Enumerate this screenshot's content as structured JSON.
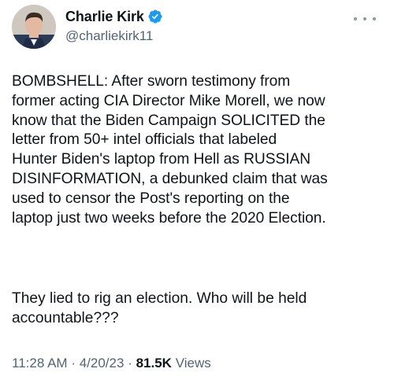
{
  "author": {
    "name": "Charlie Kirk",
    "handle": "@charliekirk11",
    "verified": true,
    "avatar": "profile-photo"
  },
  "tweet": {
    "paragraph1": "BOMBSHELL: After sworn testimony from\nformer acting CIA Director Mike Morell, we now\nknow that the Biden Campaign SOLICITED the\nletter from 50+ intel officials that labeled\nHunter Biden's laptop from Hell as RUSSIAN\nDISINFORMATION, a debunked claim that was\nused to censor the Post's reporting on the\nlaptop just two weeks before the 2020 Election.",
    "paragraph2": "They lied to rig an election. Who will be held\naccountable???"
  },
  "meta": {
    "time": "11:28 AM",
    "separator": "·",
    "date": "4/20/23",
    "views_count": "81.5K",
    "views_label": "Views"
  },
  "icons": {
    "verified": "verified-badge-icon",
    "more": "more-options-icon"
  },
  "colors": {
    "verified_blue": "#1d9bf0",
    "secondary_text": "#536471",
    "primary_text": "#0f1419"
  }
}
